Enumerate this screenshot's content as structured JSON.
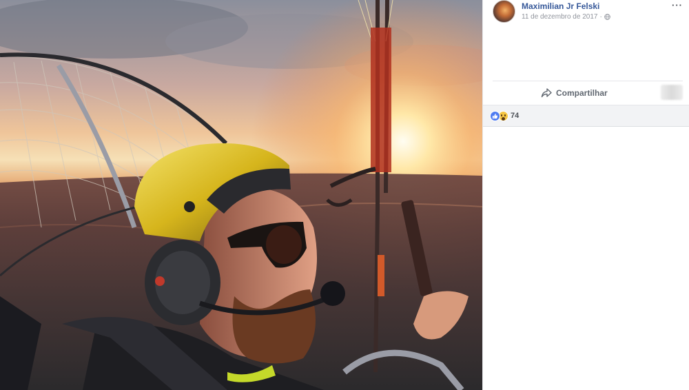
{
  "post": {
    "author": "Maximilian Jr Felski",
    "date": "11 de dezembro de 2017",
    "date_separator": "·",
    "more_label": "···",
    "privacy_icon": "globe-icon"
  },
  "actions": {
    "share_label": "Compartilhar",
    "share_icon": "share-arrow-icon"
  },
  "reactions": {
    "count": "74",
    "types": [
      "like",
      "wow"
    ]
  },
  "colors": {
    "author_link": "#365899",
    "like_blue": "#4d7bf1",
    "wow_yellow": "#f5c542",
    "reactions_bg": "#f2f3f5"
  }
}
